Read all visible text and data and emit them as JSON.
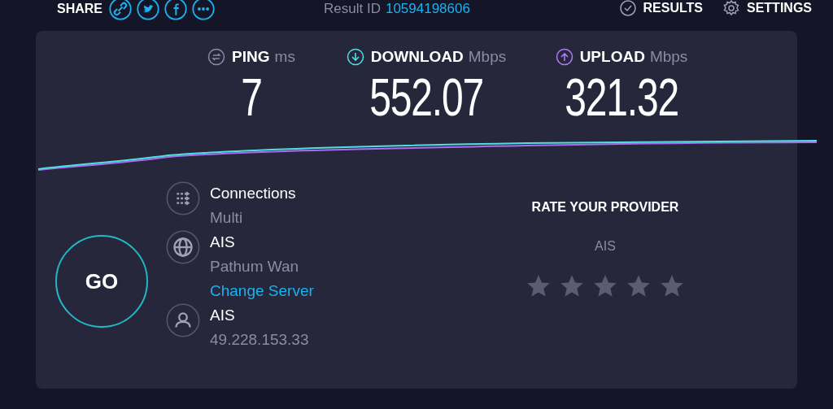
{
  "header": {
    "share_label": "SHARE",
    "share_icons": [
      {
        "kind": "link"
      },
      {
        "kind": "twitter"
      },
      {
        "kind": "facebook"
      },
      {
        "kind": "more"
      }
    ],
    "result_label": "Result ID",
    "result_id": "10594198606",
    "nav": [
      {
        "label": "RESULTS",
        "kind": "results"
      },
      {
        "label": "SETTINGS",
        "kind": "settings"
      }
    ]
  },
  "metrics": [
    {
      "kind": "ping",
      "label": "PING",
      "unit": "ms",
      "value": "7"
    },
    {
      "kind": "download",
      "label": "DOWNLOAD",
      "unit": "Mbps",
      "value": "552.07"
    },
    {
      "kind": "upload",
      "label": "UPLOAD",
      "unit": "Mbps",
      "value": "321.32"
    }
  ],
  "go_button": "GO",
  "info": [
    {
      "kind": "connections",
      "title": "Connections",
      "lines": [
        {
          "text": "Multi",
          "kind": "detail"
        }
      ]
    },
    {
      "kind": "server",
      "title": "AIS",
      "lines": [
        {
          "text": "Pathum Wan",
          "kind": "detail"
        },
        {
          "text": "Change Server",
          "kind": "link"
        }
      ]
    },
    {
      "kind": "provider",
      "title": "AIS",
      "lines": [
        {
          "text": "49.228.153.33",
          "kind": "detail"
        }
      ]
    }
  ],
  "rating": {
    "title": "RATE YOUR PROVIDER",
    "provider": "AIS",
    "stars": 0
  }
}
